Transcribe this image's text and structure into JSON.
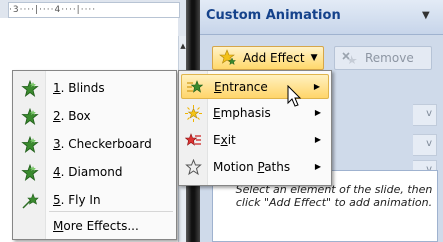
{
  "ruler": {
    "text": "·3····|····4····|····"
  },
  "task_pane": {
    "title": "Custom Animation",
    "menu_glyph": "▼",
    "add_effect": {
      "label": "Add Effect",
      "icon": "star-sparkle-icon"
    },
    "remove": {
      "label": "Remove",
      "icon": "remove-icon"
    },
    "message": "Select an element of the slide, then click \"Add Effect\" to add animation."
  },
  "effect_menu": {
    "items": [
      {
        "key": "E",
        "rest": "ntrance",
        "icon": "entrance-star-icon",
        "active": true
      },
      {
        "key": "E",
        "rest": "mphasis",
        "icon": "emphasis-star-icon",
        "active": false
      },
      {
        "key": "x",
        "pre": "E",
        "rest": "it",
        "icon": "exit-star-icon",
        "active": false
      },
      {
        "pre": "Motion ",
        "key": "P",
        "rest": "aths",
        "icon": "motion-path-star-icon",
        "active": false
      }
    ]
  },
  "entrance_submenu": {
    "items": [
      {
        "num": "1",
        "label": ". Blinds",
        "icon": "green-star-icon"
      },
      {
        "num": "2",
        "label": ". Box",
        "icon": "green-star-icon"
      },
      {
        "num": "3",
        "label": ". Checkerboard",
        "icon": "green-star-icon"
      },
      {
        "num": "4",
        "label": ". Diamond",
        "icon": "green-star-icon"
      },
      {
        "num": "5",
        "label": ". Fly In",
        "icon": "fly-in-star-icon"
      }
    ],
    "more": {
      "key": "M",
      "rest": "ore Effects..."
    }
  },
  "colors": {
    "pane_bg": "#cfdaea",
    "title": "#15428b",
    "highlight": "#ffd56a",
    "green_star": "#3a8a2e"
  }
}
